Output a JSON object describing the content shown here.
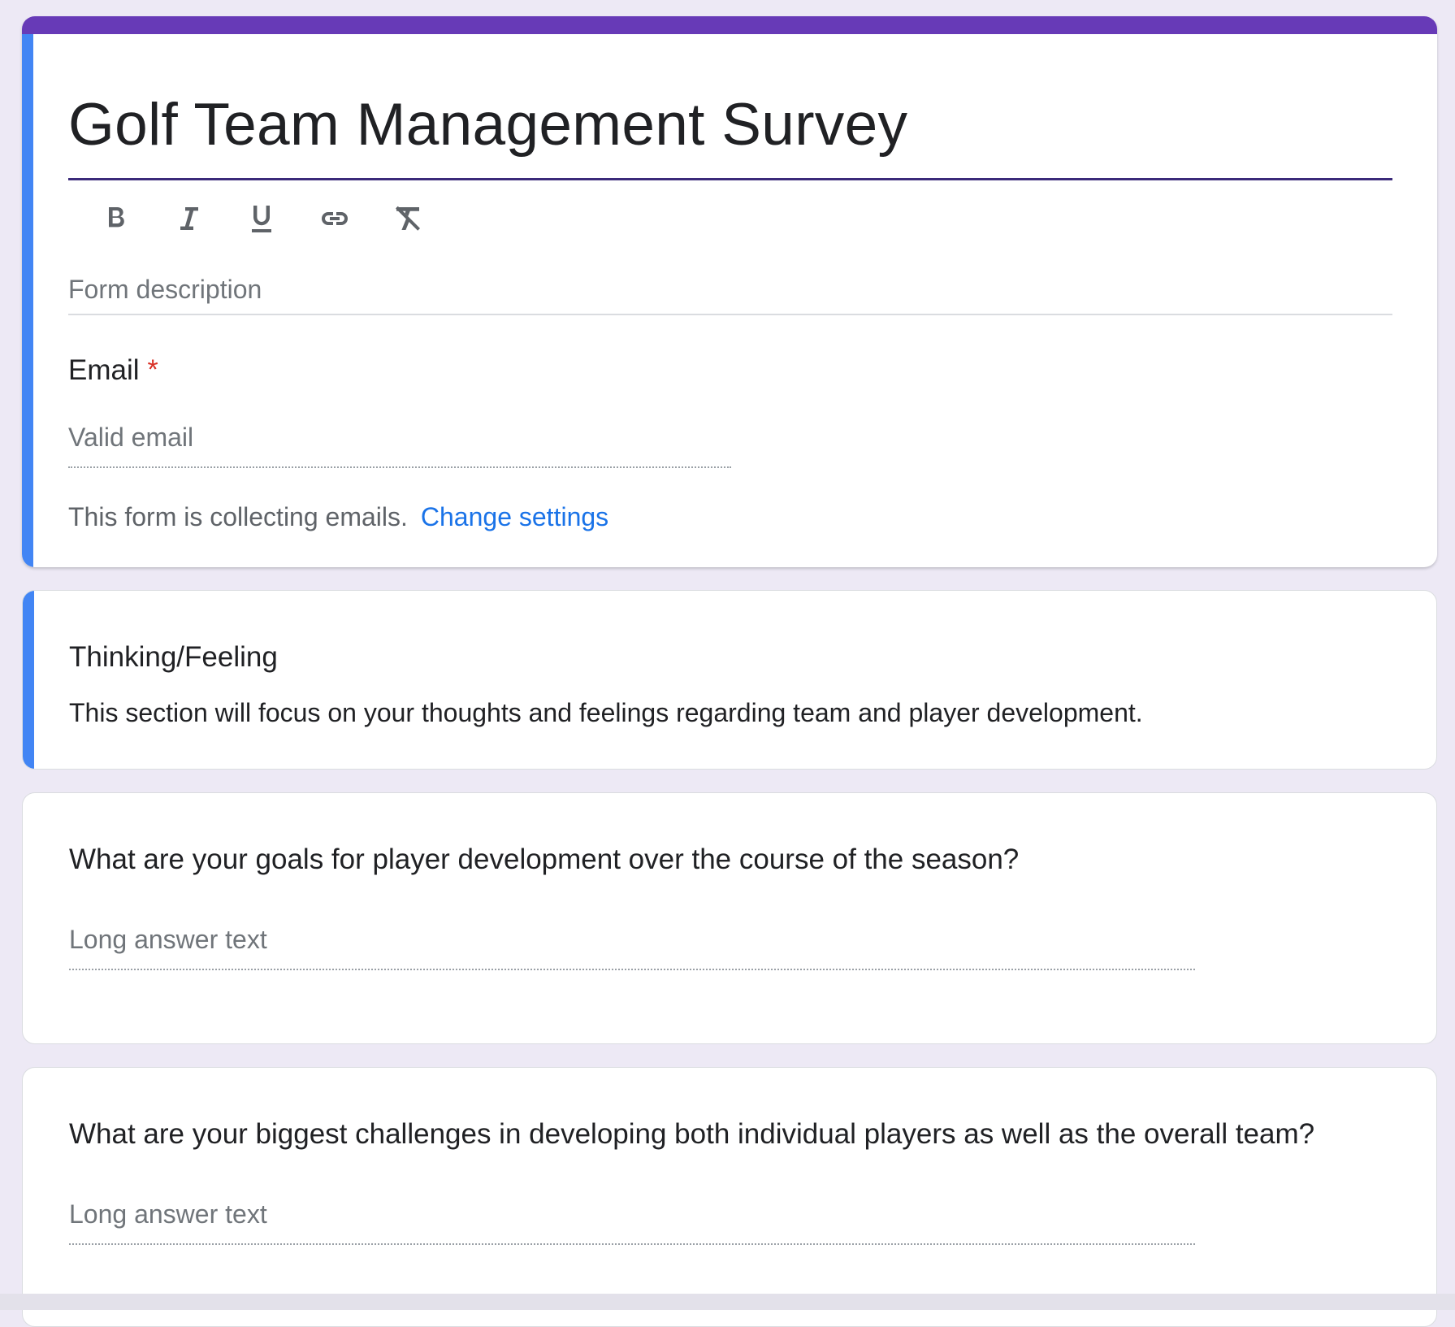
{
  "form": {
    "title": "Golf Team Management Survey",
    "description_placeholder": "Form description",
    "toolbar": {
      "bold": "bold-icon",
      "italic": "italic-icon",
      "underline": "underline-icon",
      "link": "link-icon",
      "clear_format": "clear-format-icon"
    },
    "email": {
      "label": "Email",
      "required_mark": "*",
      "placeholder": "Valid email",
      "note": "This form is collecting emails.",
      "change_link": "Change settings"
    }
  },
  "section": {
    "title": "Thinking/Feeling",
    "description": "This section will focus on your thoughts and feelings regarding team and player development."
  },
  "questions": [
    {
      "title": "What are your goals for player development over the course of the season?",
      "placeholder": "Long answer text"
    },
    {
      "title": "What are your biggest challenges in developing both individual players as well as the overall team?",
      "placeholder": "Long answer text"
    }
  ],
  "colors": {
    "theme": "#673ab7",
    "accent": "#4285f4",
    "background": "#ede9f5",
    "required": "#d93025",
    "link": "#1a73e8"
  }
}
